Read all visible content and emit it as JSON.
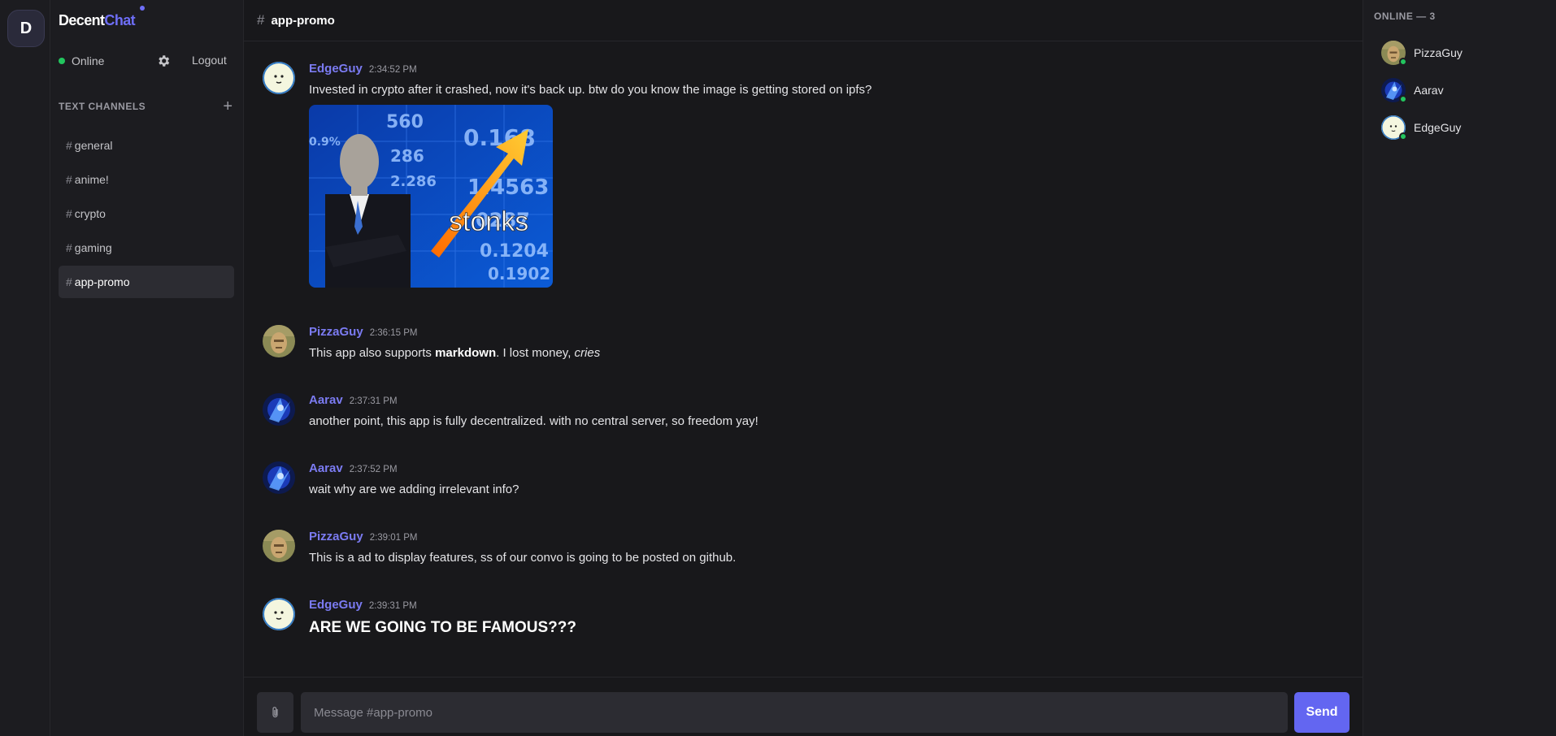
{
  "server": {
    "initial": "D"
  },
  "brand": {
    "part1": "Decent",
    "part2": "Chat"
  },
  "user_status": {
    "label": "Online",
    "logout_label": "Logout",
    "status_color": "#22c55e"
  },
  "channels_section": {
    "title": "TEXT CHANNELS",
    "add_label": "+"
  },
  "channels": [
    {
      "label": "general",
      "active": false
    },
    {
      "label": "anime!",
      "active": false
    },
    {
      "label": "crypto",
      "active": false
    },
    {
      "label": "gaming",
      "active": false
    },
    {
      "label": "app-promo",
      "active": true
    }
  ],
  "header": {
    "hash": "#",
    "channel": "app-promo"
  },
  "messages": [
    {
      "author": "EdgeGuy",
      "time": "2:34:52 PM",
      "text": "Invested in crypto after it crashed, now it's back up. btw do you know the image is getting stored on ipfs?",
      "image_caption": "stonks"
    },
    {
      "author": "PizzaGuy",
      "time": "2:36:15 PM",
      "text_before": "This app also supports ",
      "bold": "markdown",
      "text_mid": ". I lost money, ",
      "italic": "cries"
    },
    {
      "author": "Aarav",
      "time": "2:37:31 PM",
      "text": "another point, this app is fully decentralized. with no central server, so freedom yay!"
    },
    {
      "author": "Aarav",
      "time": "2:37:52 PM",
      "text": "wait why are we adding irrelevant info?"
    },
    {
      "author": "PizzaGuy",
      "time": "2:39:01 PM",
      "text": "This is a ad to display features, ss of our convo is going to be posted on github."
    },
    {
      "author": "EdgeGuy",
      "time": "2:39:31 PM",
      "text": "ARE WE GOING TO BE FAMOUS???"
    }
  ],
  "composer": {
    "placeholder": "Message #app-promo",
    "send_label": "Send"
  },
  "members": {
    "title": "ONLINE — 3",
    "list": [
      {
        "name": "PizzaGuy"
      },
      {
        "name": "Aarav"
      },
      {
        "name": "EdgeGuy"
      }
    ]
  },
  "colors": {
    "accent": "#6366f1",
    "author": "#7b7bf2",
    "online": "#22c55e"
  }
}
